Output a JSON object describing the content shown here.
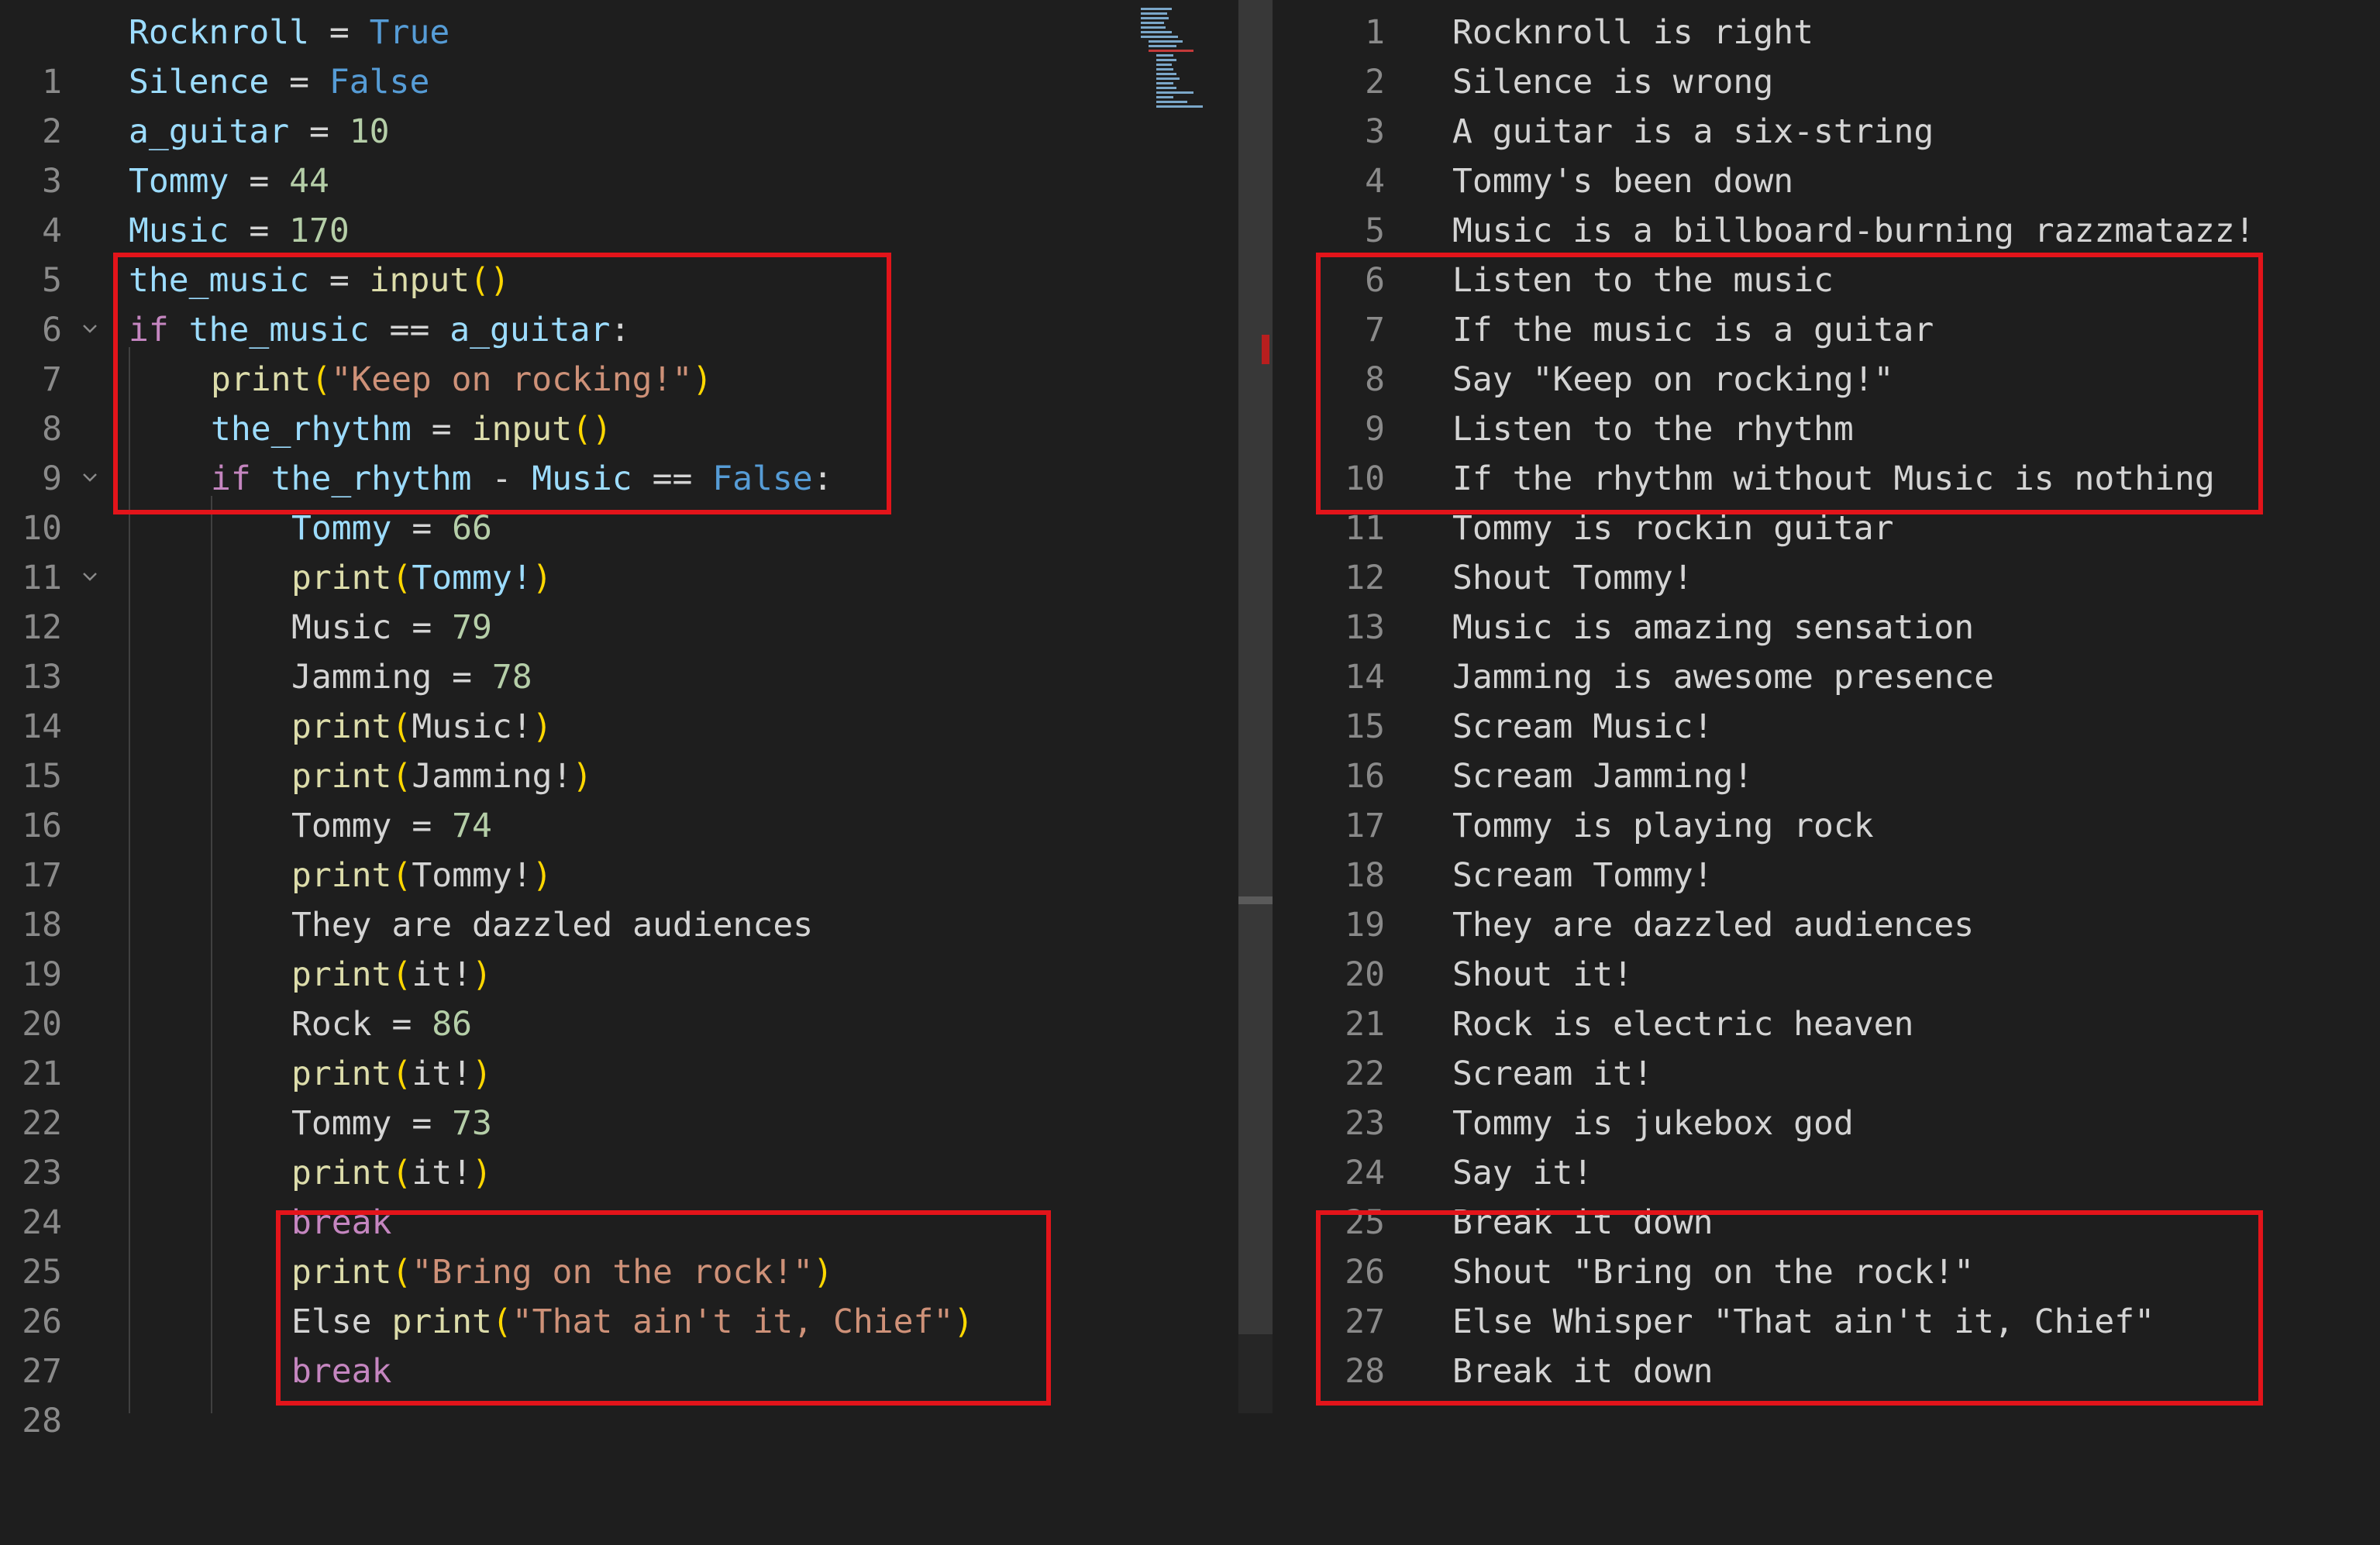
{
  "colors": {
    "background": "#1e1e1e",
    "line_number": "#8a8a8a",
    "variable": "#9cdcfe",
    "function": "#dcdcaa",
    "keyword": "#c586c0",
    "constant": "#569cd6",
    "number": "#b5cea8",
    "string": "#ce9178",
    "highlight_box": "#e3141a"
  },
  "icons": {
    "fold": "chevron-down-icon"
  },
  "left_editor": {
    "line_numbers": [
      "1",
      "2",
      "3",
      "4",
      "5",
      "6",
      "7",
      "8",
      "9",
      "10",
      "11",
      "12",
      "13",
      "14",
      "15",
      "16",
      "17",
      "18",
      "19",
      "20",
      "21",
      "22",
      "23",
      "24",
      "25",
      "26",
      "27",
      "28"
    ],
    "tokens": {
      "l1": [
        "Rocknroll",
        " = ",
        "True"
      ],
      "l2": [
        "Silence",
        " = ",
        "False"
      ],
      "l3": [
        "a_guitar",
        " = ",
        "10"
      ],
      "l4": [
        "Tommy",
        " = ",
        "44"
      ],
      "l5": [
        "Music",
        " = ",
        "170"
      ],
      "l6": [
        "the_music",
        " = ",
        "input",
        "()"
      ],
      "l7": [
        "if",
        " ",
        "the_music",
        " == ",
        "a_guitar",
        ":"
      ],
      "l8": [
        "print",
        "(",
        "\"Keep on rocking!\"",
        ")"
      ],
      "l9": [
        "the_rhythm",
        " = ",
        "input",
        "()"
      ],
      "l10": [
        "if",
        " ",
        "the_rhythm",
        " - ",
        "Music",
        " == ",
        "False",
        ":"
      ],
      "l11": [
        "Tommy",
        " = ",
        "66"
      ],
      "l12": [
        "print",
        "(",
        "Tommy!",
        ")"
      ],
      "l13": [
        "Music = ",
        "79"
      ],
      "l14": [
        "Jamming = ",
        "78"
      ],
      "l15": [
        "print",
        "(",
        "Music!",
        ")"
      ],
      "l16": [
        "print",
        "(",
        "Jamming!",
        ")"
      ],
      "l17": [
        "Tommy",
        " = ",
        "74"
      ],
      "l18": [
        "print",
        "(",
        "Tommy!",
        ")"
      ],
      "l19": [
        "They are dazzled audiences"
      ],
      "l20": [
        "print",
        "(",
        "it!",
        ")"
      ],
      "l21": [
        "Rock = ",
        "86"
      ],
      "l22": [
        "print",
        "(",
        "it!",
        ")"
      ],
      "l23": [
        "Tommy",
        " = ",
        "73"
      ],
      "l24": [
        "print",
        "(",
        "it!",
        ")"
      ],
      "l25": [
        "break"
      ],
      "l26": [
        "print",
        "(",
        "\"Bring on the rock!\"",
        ")"
      ],
      "l27": [
        "Else ",
        "print",
        "(",
        "\"That ain't it, Chief\"",
        ")"
      ],
      "l28": [
        "break"
      ]
    }
  },
  "right_editor": {
    "line_numbers": [
      "1",
      "2",
      "3",
      "4",
      "5",
      "6",
      "7",
      "8",
      "9",
      "10",
      "11",
      "12",
      "13",
      "14",
      "15",
      "16",
      "17",
      "18",
      "19",
      "20",
      "21",
      "22",
      "23",
      "24",
      "25",
      "26",
      "27",
      "28"
    ],
    "lines": [
      "Rocknroll is right",
      "Silence is wrong",
      "A guitar is a six-string",
      "Tommy's been down",
      "Music is a billboard-burning razzmatazz!",
      "Listen to the music",
      "If the music is a guitar",
      "Say \"Keep on rocking!\"",
      "Listen to the rhythm",
      "If the rhythm without Music is nothing",
      "Tommy is rockin guitar",
      "Shout Tommy!",
      "Music is amazing sensation",
      "Jamming is awesome presence",
      "Scream Music!",
      "Scream Jamming!",
      "Tommy is playing rock",
      "Scream Tommy!",
      "They are dazzled audiences",
      "Shout it!",
      "Rock is electric heaven",
      "Scream it!",
      "Tommy is jukebox god",
      "Say it!",
      "Break it down",
      "Shout \"Bring on the rock!\"",
      "Else Whisper \"That ain't it, Chief\"",
      "Break it down"
    ]
  }
}
